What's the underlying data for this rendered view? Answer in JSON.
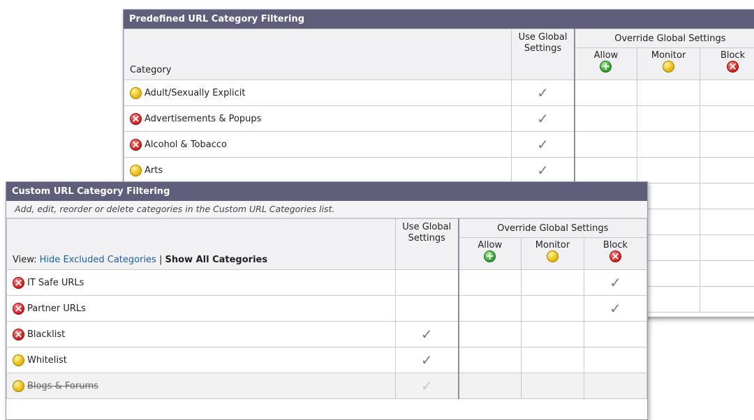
{
  "predefined": {
    "title": "Predefined URL Category Filtering",
    "headers": {
      "category": "Category",
      "use_global": "Use Global Settings",
      "override": "Override Global Settings",
      "allow": "Allow",
      "monitor": "Monitor",
      "block": "Block"
    },
    "rows": [
      {
        "name": "Adult/Sexually Explicit",
        "icon": "monitor-icon",
        "global_check": true
      },
      {
        "name": "Advertisements & Popups",
        "icon": "block-icon",
        "global_check": true
      },
      {
        "name": "Alcohol & Tobacco",
        "icon": "block-icon",
        "global_check": true
      },
      {
        "name": "Arts",
        "icon": "monitor-icon",
        "global_check": true
      }
    ]
  },
  "custom": {
    "title": "Custom URL Category Filtering",
    "subtitle": "Add, edit, reorder or delete categories in the Custom URL Categories list.",
    "view": {
      "prefix": "View:",
      "hide_link": "Hide Excluded Categories",
      "separator": "|",
      "show_all": "Show All Categories"
    },
    "headers": {
      "use_global": "Use Global Settings",
      "override": "Override Global Settings",
      "allow": "Allow",
      "monitor": "Monitor",
      "block": "Block"
    },
    "rows": [
      {
        "name": "IT Safe URLs",
        "icon": "block-icon",
        "global_check": false,
        "block_check": true,
        "excluded": false
      },
      {
        "name": "Partner URLs",
        "icon": "block-icon",
        "global_check": false,
        "block_check": true,
        "excluded": false
      },
      {
        "name": "Blacklist",
        "icon": "block-icon",
        "global_check": true,
        "block_check": false,
        "excluded": false
      },
      {
        "name": "Whitelist",
        "icon": "monitor-icon",
        "global_check": true,
        "block_check": false,
        "excluded": false
      },
      {
        "name": "Blogs & Forums",
        "icon": "monitor-icon",
        "global_check": true,
        "block_check": false,
        "excluded": true
      }
    ]
  },
  "checkmark_glyph": "✓",
  "colors": {
    "title_bar": "#5f5f7c",
    "block": "#c81e1e",
    "monitor": "#e3b400",
    "allow": "#2f9a2c",
    "link": "#1f5d9d"
  }
}
